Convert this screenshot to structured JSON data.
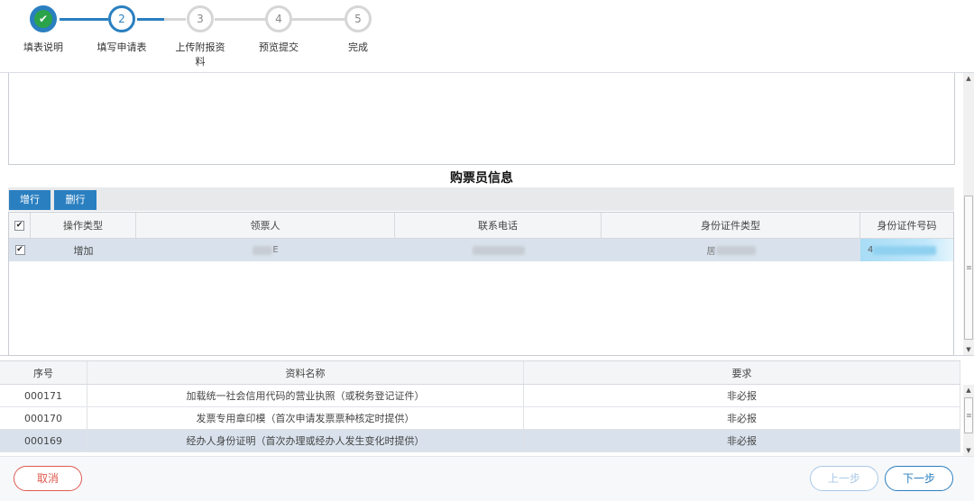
{
  "stepper": {
    "steps": [
      {
        "number": "✔",
        "label": "填表说明",
        "state": "done"
      },
      {
        "number": "2",
        "label": "填写申请表",
        "state": "active"
      },
      {
        "number": "3",
        "label": "上传附报资料",
        "state": "todo"
      },
      {
        "number": "4",
        "label": "预览提交",
        "state": "todo"
      },
      {
        "number": "5",
        "label": "完成",
        "state": "todo"
      }
    ]
  },
  "buyer_section": {
    "title": "购票员信息",
    "add_row_label": "增行",
    "delete_row_label": "删行",
    "columns": [
      "操作类型",
      "领票人",
      "联系电话",
      "身份证件类型",
      "身份证件号码"
    ],
    "header_checked": "✔",
    "rows": [
      {
        "checked": "✔",
        "operation": "增加",
        "recipient_tail": "E",
        "phone": "",
        "id_type_head": "居",
        "id_number_head": "4"
      }
    ]
  },
  "materials": {
    "columns": [
      "序号",
      "资料名称",
      "要求"
    ],
    "rows": [
      {
        "no": "000171",
        "name": "加载统一社会信用代码的营业执照（或税务登记证件）",
        "requirement": "非必报"
      },
      {
        "no": "000170",
        "name": "发票专用章印模（首次申请发票票种核定时提供）",
        "requirement": "非必报"
      },
      {
        "no": "000169",
        "name": "经办人身份证明（首次办理或经办人发生变化时提供）",
        "requirement": "非必报"
      }
    ]
  },
  "footer": {
    "cancel_label": "取消",
    "prev_label": "上一步",
    "next_label": "下一步"
  },
  "colors": {
    "accent": "#2a7fc0",
    "success": "#2ba34a",
    "danger": "#e05a4f",
    "row_selected": "#d9e2ec"
  }
}
